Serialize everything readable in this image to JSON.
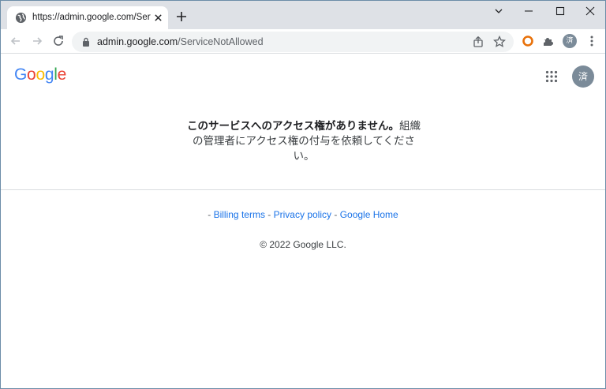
{
  "browser": {
    "tab_title": "https://admin.google.com/ServiceNotAllowed",
    "url_host": "admin.google.com",
    "url_path": "/ServiceNotAllowed",
    "profile_initial": "済"
  },
  "page": {
    "logo_letters": [
      "G",
      "o",
      "o",
      "g",
      "l",
      "e"
    ],
    "avatar_initial": "済",
    "message_bold": "このサービスへのアクセス権がありません。",
    "message_rest": "組織の管理者にアクセス権の付与を依頼してください。",
    "footer": {
      "sep": "-",
      "billing_terms": "Billing terms",
      "privacy_policy": "Privacy policy",
      "google_home": "Google Home",
      "copyright": "© 2022 Google LLC."
    }
  },
  "colors": {
    "tabstrip": "#dee1e6",
    "link": "#1a73e8",
    "avatar": "#7b8b99"
  }
}
